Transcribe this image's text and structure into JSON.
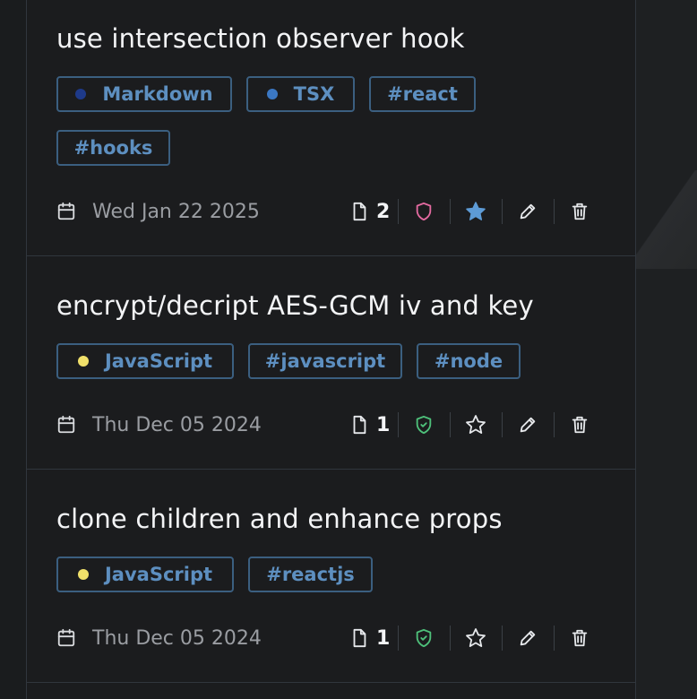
{
  "colors": {
    "markdown_dot": "#1e3a8a",
    "tsx_dot": "#3b78c4",
    "javascript_dot": "#f0e06a",
    "shield_private": "#e36aa0",
    "shield_public": "#4ec07a",
    "star_filled": "#5d9bd6",
    "tag_text": "#5d8fc0",
    "tag_border": "#3b5f80"
  },
  "cards": [
    {
      "title": "use intersection observer hook",
      "tags": [
        {
          "label": "Markdown",
          "dot": "markdown_dot"
        },
        {
          "label": "TSX",
          "dot": "tsx_dot"
        },
        {
          "label": "#react"
        },
        {
          "label": "#hooks"
        }
      ],
      "date": "Wed Jan 22 2025",
      "file_count": "2",
      "visibility_icon": "shield-icon",
      "starred": true
    },
    {
      "title": "encrypt/decript AES-GCM iv and key",
      "tags": [
        {
          "label": "JavaScript",
          "dot": "javascript_dot"
        },
        {
          "label": "#javascript"
        },
        {
          "label": "#node"
        }
      ],
      "date": "Thu Dec 05 2024",
      "file_count": "1",
      "visibility_icon": "shield-check-icon",
      "starred": false
    },
    {
      "title": "clone children and enhance props",
      "tags": [
        {
          "label": "JavaScript",
          "dot": "javascript_dot"
        },
        {
          "label": "#reactjs"
        }
      ],
      "date": "Thu Dec 05 2024",
      "file_count": "1",
      "visibility_icon": "shield-check-icon",
      "starred": false
    }
  ],
  "icons": [
    "calendar-icon",
    "file-icon",
    "shield-icon",
    "shield-check-icon",
    "star-icon",
    "pencil-icon",
    "trash-icon"
  ]
}
